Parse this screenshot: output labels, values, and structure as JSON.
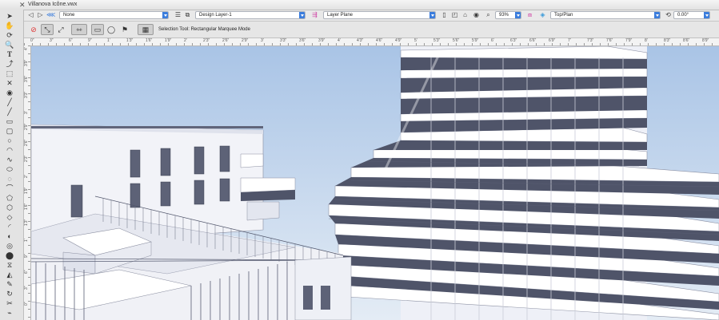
{
  "window": {
    "title": "Villanova Icône.vwx",
    "close_glyph": "✕"
  },
  "view_bar": {
    "class_select": "None",
    "layer_select": "Design Layer-1",
    "plane_select": "Layer Plane",
    "zoom": "93%",
    "view_select": "Top/Plan",
    "rotation": "0.00°"
  },
  "tool_bar": {
    "mode_text": "Selection Tool: Rectangular Marquee Mode"
  },
  "rulers": {
    "top": [
      "0\"",
      "3\"",
      "6\"",
      "9\"",
      "1'",
      "1'3\"",
      "1'6\"",
      "1'9\"",
      "2'",
      "2'3\"",
      "2'6\"",
      "2'9\"",
      "3'",
      "3'3\"",
      "3'6\"",
      "3'9\"",
      "4'",
      "4'3\"",
      "4'6\"",
      "4'9\"",
      "5'",
      "5'3\"",
      "5'6\"",
      "5'9\"",
      "6'",
      "6'3\"",
      "6'6\"",
      "6'9\"",
      "7'",
      "7'3\"",
      "7'6\"",
      "7'9\"",
      "8'",
      "8'3\"",
      "8'6\"",
      "8'9\""
    ],
    "left": [
      "4'",
      "3'9\"",
      "3'6\"",
      "3'3\"",
      "3'",
      "2'9\"",
      "2'6\"",
      "2'3\"",
      "2'",
      "1'9\"",
      "1'6\"",
      "1'3\"",
      "1'",
      "9\"",
      "6\"",
      "3\"",
      "0\""
    ]
  },
  "colors": {
    "sky_top": "#a9c4e6",
    "sky_bottom": "#e4ecf5",
    "accent": "#3b7ddd",
    "facade": "#f2f3f8",
    "glass": "#5d6277"
  }
}
